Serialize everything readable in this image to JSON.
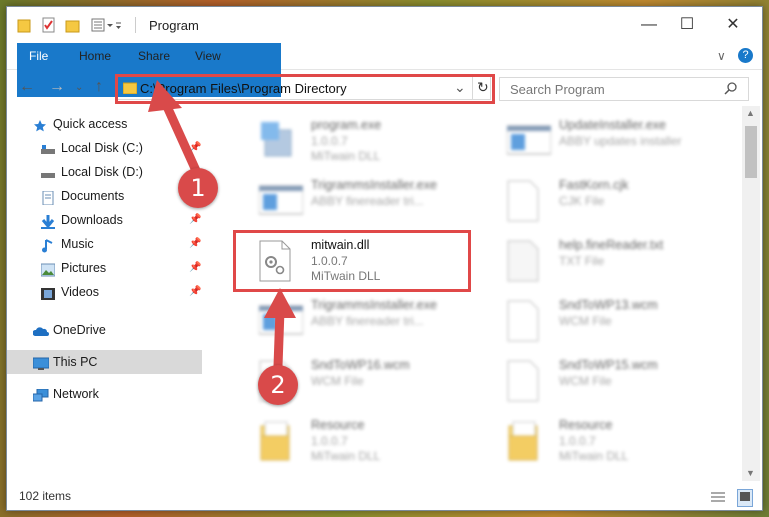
{
  "window": {
    "title": "Program",
    "controls": {
      "minimize": "—",
      "maximize": "☐",
      "close": "✕"
    }
  },
  "ribbon": {
    "tabs": [
      "File",
      "Home",
      "Share",
      "View"
    ],
    "collapse": "∨",
    "help": "?"
  },
  "address": {
    "path": "C:\\Program Files\\Program Directory",
    "dropdown": "⌄",
    "refresh": "↻"
  },
  "search": {
    "placeholder": "Search Program"
  },
  "nav": {
    "quick_access": "Quick access",
    "items": [
      {
        "label": "Local Disk (C:)",
        "icon": "drive-icon",
        "pinned": true
      },
      {
        "label": "Local Disk (D:)",
        "icon": "drive-icon",
        "pinned": false
      },
      {
        "label": "Documents",
        "icon": "documents-icon",
        "pinned": true
      },
      {
        "label": "Downloads",
        "icon": "downloads-icon",
        "pinned": true
      },
      {
        "label": "Music",
        "icon": "music-icon",
        "pinned": true
      },
      {
        "label": "Pictures",
        "icon": "pictures-icon",
        "pinned": true
      },
      {
        "label": "Videos",
        "icon": "videos-icon",
        "pinned": true
      }
    ],
    "onedrive": "OneDrive",
    "thispc": "This PC",
    "network": "Network"
  },
  "files": [
    {
      "name": "program.exe",
      "line1": "1.0.0.7",
      "line2": "MiTwain DLL",
      "col": 0,
      "row": 0,
      "icon": "exe"
    },
    {
      "name": "UpdateInstaller.exe",
      "line1": "ABBY updates installer",
      "line2": "",
      "col": 1,
      "row": 0,
      "icon": "window"
    },
    {
      "name": "TrigrammsInstaller.exe",
      "line1": "ABBY finereader tri...",
      "line2": "",
      "col": 0,
      "row": 1,
      "icon": "window"
    },
    {
      "name": "FastKorn.cjk",
      "line1": "CJK File",
      "line2": "",
      "col": 1,
      "row": 1,
      "icon": "blank"
    },
    {
      "name": "mitwain.dll",
      "line1": "1.0.0.7",
      "line2": "MiTwain DLL",
      "col": 0,
      "row": 2,
      "icon": "dll",
      "highlight": true
    },
    {
      "name": "help.fineReader.txt",
      "line1": "TXT File",
      "line2": "",
      "col": 1,
      "row": 2,
      "icon": "txt"
    },
    {
      "name": "TrigrammsInstaller.exe",
      "line1": "ABBY finereader tri...",
      "line2": "",
      "col": 0,
      "row": 3,
      "icon": "window"
    },
    {
      "name": "SndToWP13.wcm",
      "line1": "WCM File",
      "line2": "",
      "col": 1,
      "row": 3,
      "icon": "blank"
    },
    {
      "name": "SndToWP16.wcm",
      "line1": "WCM File",
      "line2": "",
      "col": 0,
      "row": 4,
      "icon": "blank"
    },
    {
      "name": "SndToWP15.wcm",
      "line1": "WCM File",
      "line2": "",
      "col": 1,
      "row": 4,
      "icon": "blank"
    },
    {
      "name": "Resource",
      "line1": "1.0.0.7",
      "line2": "MiTwain DLL",
      "col": 0,
      "row": 5,
      "icon": "folder"
    },
    {
      "name": "Resource",
      "line1": "1.0.0.7",
      "line2": "MiTwain DLL",
      "col": 1,
      "row": 5,
      "icon": "folder"
    }
  ],
  "status": {
    "count": "102 items"
  },
  "annotations": {
    "step1": "1",
    "step2": "2"
  },
  "colors": {
    "accent": "#1979ca",
    "highlight": "#e04848",
    "callout": "#d94a4a"
  }
}
